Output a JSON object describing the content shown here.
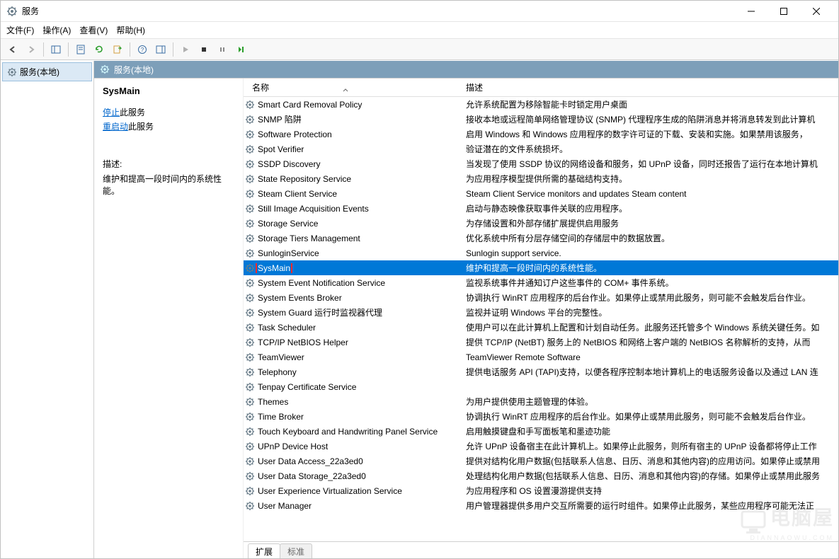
{
  "window": {
    "title": "服务"
  },
  "menu": {
    "file": "文件(F)",
    "action": "操作(A)",
    "view": "查看(V)",
    "help": "帮助(H)"
  },
  "tree": {
    "root": "服务(本地)"
  },
  "header": {
    "title": "服务(本地)"
  },
  "detail": {
    "title": "SysMain",
    "stop_link": "停止",
    "stop_suffix": "此服务",
    "restart_link": "重启动",
    "restart_suffix": "此服务",
    "desc_label": "描述:",
    "desc": "维护和提高一段时间内的系统性能。"
  },
  "columns": {
    "name": "名称",
    "desc": "描述"
  },
  "services": [
    {
      "name": "Smart Card Removal Policy",
      "desc": "允许系统配置为移除智能卡时锁定用户桌面"
    },
    {
      "name": "SNMP 陷阱",
      "desc": "接收本地或远程简单网络管理协议 (SNMP) 代理程序生成的陷阱消息并将消息转发到此计算机"
    },
    {
      "name": "Software Protection",
      "desc": "启用 Windows 和 Windows 应用程序的数字许可证的下载、安装和实施。如果禁用该服务，"
    },
    {
      "name": "Spot Verifier",
      "desc": "验证潜在的文件系统损坏。"
    },
    {
      "name": "SSDP Discovery",
      "desc": "当发现了使用 SSDP 协议的网络设备和服务，如 UPnP 设备，同时还报告了运行在本地计算机"
    },
    {
      "name": "State Repository Service",
      "desc": "为应用程序模型提供所需的基础结构支持。"
    },
    {
      "name": "Steam Client Service",
      "desc": "Steam Client Service monitors and updates Steam content"
    },
    {
      "name": "Still Image Acquisition Events",
      "desc": "启动与静态映像获取事件关联的应用程序。"
    },
    {
      "name": "Storage Service",
      "desc": "为存储设置和外部存储扩展提供启用服务"
    },
    {
      "name": "Storage Tiers Management",
      "desc": "优化系统中所有分层存储空间的存储层中的数据放置。"
    },
    {
      "name": "SunloginService",
      "desc": "Sunlogin support service."
    },
    {
      "name": "SysMain",
      "desc": "维护和提高一段时间内的系统性能。",
      "selected": true,
      "highlighted": true
    },
    {
      "name": "System Event Notification Service",
      "desc": "监视系统事件并通知订户这些事件的 COM+ 事件系统。"
    },
    {
      "name": "System Events Broker",
      "desc": "协调执行 WinRT 应用程序的后台作业。如果停止或禁用此服务，则可能不会触发后台作业。"
    },
    {
      "name": "System Guard 运行时监视器代理",
      "desc": "监视并证明 Windows 平台的完整性。"
    },
    {
      "name": "Task Scheduler",
      "desc": "使用户可以在此计算机上配置和计划自动任务。此服务还托管多个 Windows 系统关键任务。如"
    },
    {
      "name": "TCP/IP NetBIOS Helper",
      "desc": "提供 TCP/IP (NetBT) 服务上的 NetBIOS 和网络上客户端的 NetBIOS 名称解析的支持，从而"
    },
    {
      "name": "TeamViewer",
      "desc": "TeamViewer Remote Software"
    },
    {
      "name": "Telephony",
      "desc": "提供电话服务 API (TAPI)支持，以便各程序控制本地计算机上的电话服务设备以及通过 LAN 连"
    },
    {
      "name": "Tenpay Certificate Service",
      "desc": ""
    },
    {
      "name": "Themes",
      "desc": "为用户提供使用主题管理的体验。"
    },
    {
      "name": "Time Broker",
      "desc": "协调执行 WinRT 应用程序的后台作业。如果停止或禁用此服务，则可能不会触发后台作业。"
    },
    {
      "name": "Touch Keyboard and Handwriting Panel Service",
      "desc": "启用触摸键盘和手写面板笔和墨迹功能"
    },
    {
      "name": "UPnP Device Host",
      "desc": "允许 UPnP 设备宿主在此计算机上。如果停止此服务，则所有宿主的 UPnP 设备都将停止工作"
    },
    {
      "name": "User Data Access_22a3ed0",
      "desc": "提供对结构化用户数据(包括联系人信息、日历、消息和其他内容)的应用访问。如果停止或禁用"
    },
    {
      "name": "User Data Storage_22a3ed0",
      "desc": "处理结构化用户数据(包括联系人信息、日历、消息和其他内容)的存储。如果停止或禁用此服务"
    },
    {
      "name": "User Experience Virtualization Service",
      "desc": "为应用程序和 OS 设置漫游提供支持"
    },
    {
      "name": "User Manager",
      "desc": "用户管理器提供多用户交互所需要的运行时组件。如果停止此服务，某些应用程序可能无法正"
    }
  ],
  "tabs": {
    "extended": "扩展",
    "standard": "标准"
  },
  "watermark": {
    "main": "电脑屋",
    "sub": "DIANNAOWU.COM"
  }
}
